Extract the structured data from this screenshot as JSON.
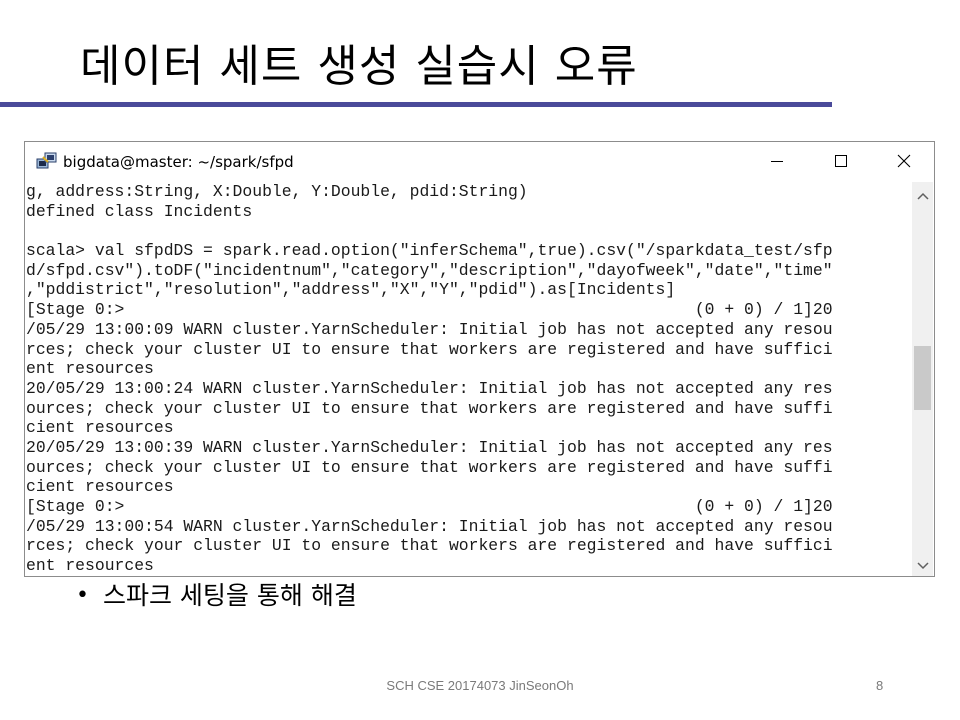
{
  "slide": {
    "title": "데이터 세트 생성 실습시 오류",
    "bullet": "스파크 세팅을 통해 해결",
    "footer": "SCH CSE 20174073 JinSeonOh",
    "page_number": "8",
    "accent_color": "#4a4a9a"
  },
  "window": {
    "title": "bigdata@master: ~/spark/sfpd",
    "app_icon": "putty-icon",
    "controls": {
      "minimize_icon": "minimize-icon",
      "maximize_icon": "maximize-icon",
      "close_icon": "close-icon"
    }
  },
  "terminal": {
    "lines": [
      "g, address:String, X:Double, Y:Double, pdid:String)",
      "defined class Incidents",
      "",
      "scala> val sfpdDS = spark.read.option(\"inferSchema\",true).csv(\"/sparkdata_test/sfp",
      "d/sfpd.csv\").toDF(\"incidentnum\",\"category\",\"description\",\"dayofweek\",\"date\",\"time\"",
      ",\"pddistrict\",\"resolution\",\"address\",\"X\",\"Y\",\"pdid\").as[Incidents]",
      "[Stage 0:>                                                          (0 + 0) / 1]20",
      "/05/29 13:00:09 WARN cluster.YarnScheduler: Initial job has not accepted any resou",
      "rces; check your cluster UI to ensure that workers are registered and have suffici",
      "ent resources",
      "20/05/29 13:00:24 WARN cluster.YarnScheduler: Initial job has not accepted any res",
      "ources; check your cluster UI to ensure that workers are registered and have suffi",
      "cient resources",
      "20/05/29 13:00:39 WARN cluster.YarnScheduler: Initial job has not accepted any res",
      "ources; check your cluster UI to ensure that workers are registered and have suffi",
      "cient resources",
      "[Stage 0:>                                                          (0 + 0) / 1]20",
      "/05/29 13:00:54 WARN cluster.YarnScheduler: Initial job has not accepted any resou",
      "rces; check your cluster UI to ensure that workers are registered and have suffici",
      "ent resources"
    ]
  }
}
